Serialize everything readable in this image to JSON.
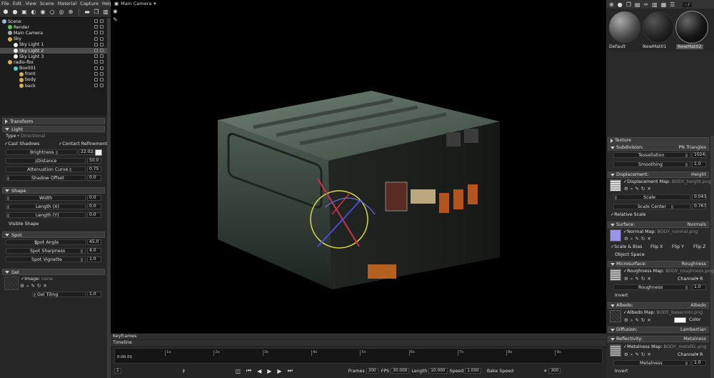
{
  "menu": [
    "File",
    "Edit",
    "View",
    "Scene",
    "Material",
    "Capture",
    "Help"
  ],
  "scene_tree": [
    {
      "label": "Scene",
      "depth": 0,
      "icon": "scene-icon",
      "color": "#9bd"
    },
    {
      "label": "Render",
      "depth": 1,
      "icon": "render-icon",
      "color": "#5c5"
    },
    {
      "label": "Main Camera",
      "depth": 1,
      "icon": "camera-icon",
      "color": "#aaa"
    },
    {
      "label": "Sky",
      "depth": 1,
      "icon": "folder-icon",
      "color": "#d9b24a"
    },
    {
      "label": "Sky Light 1",
      "depth": 2,
      "icon": "light-icon",
      "color": "#eee"
    },
    {
      "label": "Sky Light 2",
      "depth": 2,
      "icon": "light-icon",
      "color": "#eee",
      "selected": true
    },
    {
      "label": "Sky Light 3",
      "depth": 2,
      "icon": "light-icon",
      "color": "#eee"
    },
    {
      "label": "radio-fbx",
      "depth": 1,
      "icon": "folder-icon",
      "color": "#d9b24a"
    },
    {
      "label": "Box001",
      "depth": 2,
      "icon": "mesh-icon",
      "color": "#5cc"
    },
    {
      "label": "front",
      "depth": 3,
      "icon": "material-icon",
      "color": "#d9b24a"
    },
    {
      "label": "body",
      "depth": 3,
      "icon": "material-icon",
      "color": "#d9b24a"
    },
    {
      "label": "back",
      "depth": 3,
      "icon": "material-icon",
      "color": "#d9b24a"
    }
  ],
  "props": {
    "transform": "Transform",
    "light": "Light",
    "type_label": "Type",
    "type_value": "Directional",
    "cast_shadows": "Cast Shadows",
    "contact_refinement": "Contact Refinement",
    "brightness_label": "Brightness",
    "brightness_value": "22.02",
    "distance_label": "Distance",
    "distance_value": "50.0",
    "atten_label": "Attenuation Curve",
    "atten_value": "0.75",
    "shadow_offset_label": "Shadow Offset",
    "shadow_offset_value": "0.0",
    "shape": "Shape",
    "width_label": "Width",
    "width_value": "0.0",
    "length_x_label": "Length (X)",
    "length_x_value": "0.0",
    "length_y_label": "Length (Y)",
    "length_y_value": "0.0",
    "visible_shape": "Visible Shape",
    "spot": "Spot",
    "spot_angle_label": "Spot Angle",
    "spot_angle_value": "45.0",
    "spot_sharp_label": "Spot Sharpness",
    "spot_sharp_value": "4.0",
    "spot_vig_label": "Spot Vignette",
    "spot_vig_value": "1.0",
    "gel": "Gel",
    "image_label": "Image:",
    "image_value": "none",
    "gel_tiling_label": "Gel Tiling",
    "gel_tiling_value": "1.0"
  },
  "viewport": {
    "camera": "Main Camera"
  },
  "timeline": {
    "keyframes": "Keyframes",
    "timeline": "Timeline",
    "time": "0:00.01",
    "ticks": [
      "1s",
      "2s",
      "3s",
      "4s",
      "5s",
      "6s",
      "7s",
      "8s",
      "9s"
    ],
    "frames_label": "Frames",
    "frames_value": "300",
    "fps_label": "FPS",
    "fps_value": "30.000",
    "length_label": "Length",
    "length_value": "10.000",
    "speed_label": "Speed",
    "speed_value": "1.000",
    "bake_label": "Bake Speed",
    "end_value": "300",
    "start_value": "1"
  },
  "materials": {
    "items": [
      {
        "label": "Default"
      },
      {
        "label": "NewMat01"
      },
      {
        "label": "NewMat02"
      }
    ],
    "corner": "- /"
  },
  "matprops": {
    "texture": "Texture",
    "subdivision": "Subdivision:",
    "subdivision_value": "PN Triangles",
    "tessellation_label": "Tessellation",
    "tessellation_value": "1024.",
    "smoothing_label": "Smoothing",
    "smoothing_value": "1.0",
    "displacement": "Displacement:",
    "displacement_value": "Height",
    "disp_map_label": "Displacement Map:",
    "disp_map_value": "BODY_height.png",
    "scale_label": "Scale",
    "scale_value": "0.043",
    "scale_center_label": "Scale Center",
    "scale_center_value": "0.767",
    "relative_scale": "Relative Scale",
    "surface": "Surface:",
    "surface_value": "Normals",
    "normal_map_label": "Normal Map:",
    "normal_map_value": "BODY_normal.png",
    "scale_bias": "Scale & Bias",
    "flip_x": "Flip X",
    "flip_y": "Flip Y",
    "flip_z": "Flip Z",
    "object_space": "Object Space",
    "microsurface": "Microsurface:",
    "microsurface_value": "Roughness",
    "rough_map_label": "Roughness Map:",
    "rough_map_value": "BODY_roughness.png",
    "channel_label": "Channel",
    "channel_value": "R",
    "roughness_label": "Roughness",
    "roughness_value": "1.0",
    "invert": "Invert",
    "albedo": "Albedo:",
    "albedo_value": "Albedo",
    "albedo_map_label": "Albedo Map:",
    "albedo_map_value": "BODY_basecolor.png",
    "color_label": "Color",
    "diffusion": "Diffusion:",
    "diffusion_value": "Lambertian",
    "reflectivity": "Reflectivity:",
    "reflectivity_value": "Metalness",
    "metal_map_label": "Metalness Map:",
    "metal_map_value": "BODY_metallic.png",
    "metal_channel_value": "R",
    "metalness_label": "Metalness",
    "metalness_value": "1.0",
    "invert2": "Invert"
  },
  "colors": {
    "accent": "#b9a24a",
    "viewport_bg": "#000000",
    "panel": "#2b2b2b"
  }
}
